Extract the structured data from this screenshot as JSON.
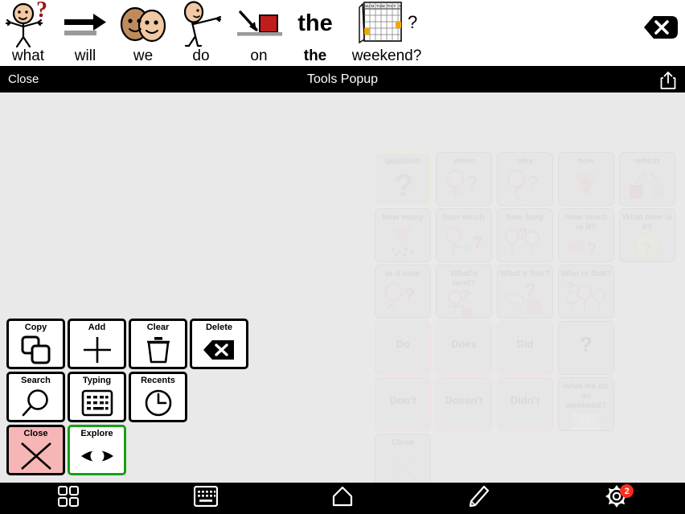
{
  "sentence_bar": {
    "words": [
      {
        "label": "what",
        "symbol": "person-question-icon",
        "bold": false
      },
      {
        "label": "will",
        "symbol": "arrow-right-icon",
        "bold": false
      },
      {
        "label": "we",
        "symbol": "two-faces-icon",
        "bold": false
      },
      {
        "label": "do",
        "symbol": "person-reaching-icon",
        "bold": false
      },
      {
        "label": "on",
        "symbol": "arrow-onto-block-icon",
        "bold": false
      },
      {
        "label": "the",
        "symbol": "word-the-icon",
        "bold": true
      },
      {
        "label": "weekend?",
        "symbol": "calendar-icon",
        "bold": false
      }
    ],
    "clear_button": "clear-sentence-icon"
  },
  "popup_header": {
    "close_label": "Close",
    "title": "Tools Popup",
    "share_icon": "share-icon"
  },
  "tools": {
    "rows": [
      [
        {
          "label": "Copy",
          "icon": "copy-icon",
          "style": "normal"
        },
        {
          "label": "Add",
          "icon": "plus-icon",
          "style": "normal"
        },
        {
          "label": "Clear",
          "icon": "trash-icon",
          "style": "normal"
        },
        {
          "label": "Delete",
          "icon": "backspace-icon",
          "style": "normal"
        }
      ],
      [
        {
          "label": "Search",
          "icon": "magnifier-icon",
          "style": "normal"
        },
        {
          "label": "Typing",
          "icon": "keyboard-icon",
          "style": "normal"
        },
        {
          "label": "Recents",
          "icon": "clock-icon",
          "style": "normal"
        }
      ],
      [
        {
          "label": "Close",
          "icon": "x-icon",
          "style": "danger"
        },
        {
          "label": "Explore",
          "icon": "eye-icon",
          "style": "selected"
        }
      ]
    ],
    "colors": {
      "danger_bg": "#f6b6b6",
      "selected_border": "#17a016",
      "border": "#000000",
      "background": "#ffffff"
    }
  },
  "background_grid": {
    "cells": [
      {
        "label": "question",
        "art": "question-mark-icon",
        "col": 0,
        "row": 0,
        "border": "yellowish"
      },
      {
        "label": "when",
        "art": "person-watch-question-icon",
        "col": 1,
        "row": 0,
        "border": "plain"
      },
      {
        "label": "why",
        "art": "person-thinking-icon",
        "col": 2,
        "row": 0,
        "border": "plain"
      },
      {
        "label": "how",
        "art": "triangle-question-icon",
        "col": 3,
        "row": 0,
        "border": "plain"
      },
      {
        "label": "which",
        "art": "two-arrows-boxes-icon",
        "col": 4,
        "row": 0,
        "border": "plain"
      },
      {
        "label": "how many",
        "art": "triangle-dots-icon",
        "col": 0,
        "row": 1,
        "border": "plain"
      },
      {
        "label": "how much",
        "art": "person-money-icon",
        "col": 1,
        "row": 1,
        "border": "plain"
      },
      {
        "label": "how long",
        "art": "two-people-question-icon",
        "col": 2,
        "row": 1,
        "border": "plain"
      },
      {
        "label": "How much is it?",
        "art": "money-question-icon",
        "col": 3,
        "row": 1,
        "border": "plain"
      },
      {
        "label": "What time is it?",
        "art": "clock-question-icon",
        "col": 4,
        "row": 1,
        "border": "plain"
      },
      {
        "label": "Is it time",
        "art": "person-watch-icon",
        "col": 0,
        "row": 2,
        "border": "plain"
      },
      {
        "label": "What's next?",
        "art": "person-gifts-icon",
        "col": 1,
        "row": 2,
        "border": "plain"
      },
      {
        "label": "What's that?",
        "art": "hand-pointing-icon",
        "col": 2,
        "row": 2,
        "border": "plain"
      },
      {
        "label": "Who is that?",
        "art": "three-people-icon",
        "col": 3,
        "row": 2,
        "border": "plain"
      },
      {
        "label": "Do",
        "art": "",
        "col": 0,
        "row": 3,
        "border": "pinkish"
      },
      {
        "label": "Does",
        "art": "",
        "col": 1,
        "row": 3,
        "border": "pinkish"
      },
      {
        "label": "Did",
        "art": "",
        "col": 2,
        "row": 3,
        "border": "pinkish"
      },
      {
        "label": "?",
        "art": "",
        "col": 3,
        "row": 3,
        "border": "plain"
      },
      {
        "label": "Don't",
        "art": "",
        "col": 0,
        "row": 4,
        "border": "pinkish"
      },
      {
        "label": "Doesn't",
        "art": "",
        "col": 1,
        "row": 4,
        "border": "pinkish"
      },
      {
        "label": "Didn't",
        "art": "",
        "col": 2,
        "row": 4,
        "border": "pinkish"
      },
      {
        "label": "what we do on weekend?",
        "art": "calendar-icon",
        "col": 3,
        "row": 4,
        "border": "plain"
      },
      {
        "label": "Close",
        "art": "x-icon",
        "col": 0,
        "row": 5,
        "border": "plain"
      }
    ]
  },
  "tabbar": {
    "items": [
      {
        "icon": "grid-icon",
        "name": "boards-tab",
        "badge": ""
      },
      {
        "icon": "keyboard-icon",
        "name": "keyboard-tab",
        "badge": ""
      },
      {
        "icon": "home-icon",
        "name": "home-tab",
        "badge": ""
      },
      {
        "icon": "pencil-icon",
        "name": "edit-tab",
        "badge": ""
      },
      {
        "icon": "gear-icon",
        "name": "settings-tab",
        "badge": "2"
      }
    ],
    "badge_color": "#fb2b1d"
  }
}
